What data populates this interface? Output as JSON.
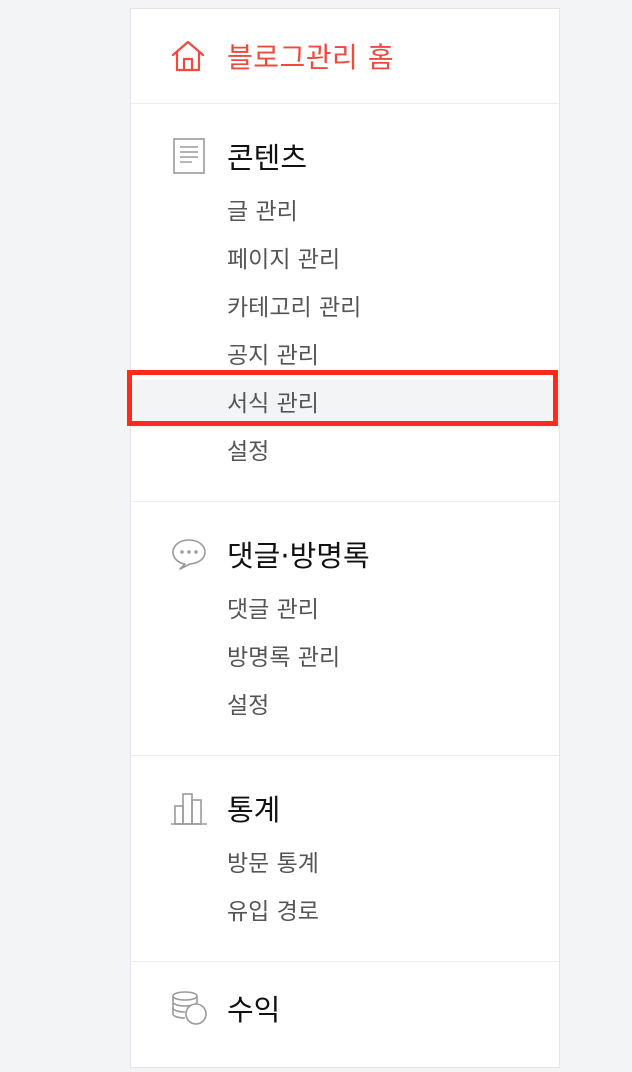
{
  "home": {
    "label": "블로그관리 홈",
    "icon": "home-icon",
    "color": "#f04a3e"
  },
  "sections": [
    {
      "title": "콘텐츠",
      "icon": "document-icon",
      "items": [
        {
          "label": "글 관리"
        },
        {
          "label": "페이지 관리"
        },
        {
          "label": "카테고리 관리"
        },
        {
          "label": "공지 관리"
        },
        {
          "label": "서식 관리",
          "highlighted": true
        },
        {
          "label": "설정"
        }
      ]
    },
    {
      "title": "댓글·방명록",
      "icon": "speech-bubble-icon",
      "items": [
        {
          "label": "댓글 관리"
        },
        {
          "label": "방명록 관리"
        },
        {
          "label": "설정"
        }
      ]
    },
    {
      "title": "통계",
      "icon": "bar-chart-icon",
      "items": [
        {
          "label": "방문 통계"
        },
        {
          "label": "유입 경로"
        }
      ]
    },
    {
      "title": "수익",
      "icon": "coins-icon",
      "items": []
    }
  ],
  "highlight_color": "#ff2a1f"
}
